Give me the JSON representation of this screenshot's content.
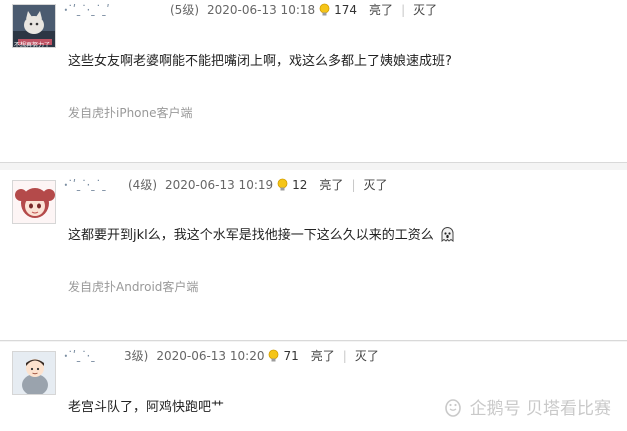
{
  "replies": [
    {
      "username": "ꞏ˙ʹˍ˙·ˍ˙ˍʹ",
      "level": "(5级)",
      "time": "2020-06-13 10:18",
      "light_count": "174",
      "light_label": "亮了",
      "dark_label": "灭了",
      "content": "这些女友啊老婆啊能不能把嘴闭上啊，戏这么多都上了姨娘速成班?",
      "source": "发自虎扑iPhone客户端",
      "avatar_caption": "不想再努力了",
      "avatar_icon": "cat-icon"
    },
    {
      "username": "ꞏ˙ʹˍ˙·ˍ˙ˍ",
      "level": "(4级)",
      "time": "2020-06-13 10:19",
      "light_count": "12",
      "light_label": "亮了",
      "dark_label": "灭了",
      "content": "这都要开到jkl么，我这个水军是找他接一下这么久以来的工资么",
      "source": "发自虎扑Android客户端",
      "avatar_icon": "anime-girl-icon",
      "emoji_icon": "ghost-emoji-icon"
    },
    {
      "username": "ꞏ˙ʹˍ˙·ˍ",
      "level": "3级)",
      "time": "2020-06-13 10:20",
      "light_count": "71",
      "light_label": "亮了",
      "dark_label": "灭了",
      "content": "老宫斗队了，阿鸡快跑吧艹",
      "avatar_icon": "cartoon-boy-icon"
    }
  ],
  "watermark": {
    "text": "企鹅号 贝塔看比赛",
    "icon": "penguin-icon"
  },
  "colors": {
    "background": "#f4f4f4",
    "card": "#ffffff",
    "meta_text": "#666666",
    "source_text": "#999999",
    "watermark": "#c9c9c9"
  }
}
